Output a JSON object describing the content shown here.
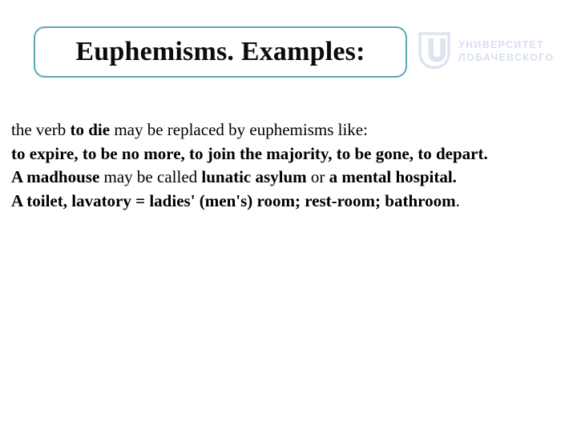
{
  "slide": {
    "title": "Euphemisms. Examples:",
    "accent_color": "#5aa8b8",
    "background_color": "#ffffff",
    "text_color": "#000000"
  },
  "logo": {
    "mark_name": "university-u-shield-mark",
    "mark_color": "#dde4f0",
    "text_color": "#d7e0ee",
    "line1": "УНИВЕРСИТЕТ",
    "line2": "ЛОБАЧЕВСКОГО"
  },
  "content": {
    "paragraphs": [
      {
        "id": "p-die",
        "runs": [
          {
            "text": "the verb ",
            "bold": false
          },
          {
            "text": "to die",
            "bold": true
          },
          {
            "text": " may be replaced by euphemisms like:",
            "bold": false
          }
        ]
      },
      {
        "id": "p-die-list",
        "runs": [
          {
            "text": "to expire, to be no more, to join the majority, to be gone, to depart.",
            "bold": true
          }
        ]
      },
      {
        "id": "p-madhouse",
        "runs": [
          {
            "text": "A madhouse",
            "bold": true
          },
          {
            "text": " may be called ",
            "bold": false
          },
          {
            "text": "lunatic asylum",
            "bold": true
          },
          {
            "text": " or ",
            "bold": false
          },
          {
            "text": "a mental hospital.",
            "bold": true
          }
        ]
      },
      {
        "id": "p-toilet",
        "runs": [
          {
            "text": "A toilet, lavatory = ladies' (men's) room; rest-room; bathroom",
            "bold": true
          },
          {
            "text": ".",
            "bold": false
          }
        ]
      }
    ]
  }
}
